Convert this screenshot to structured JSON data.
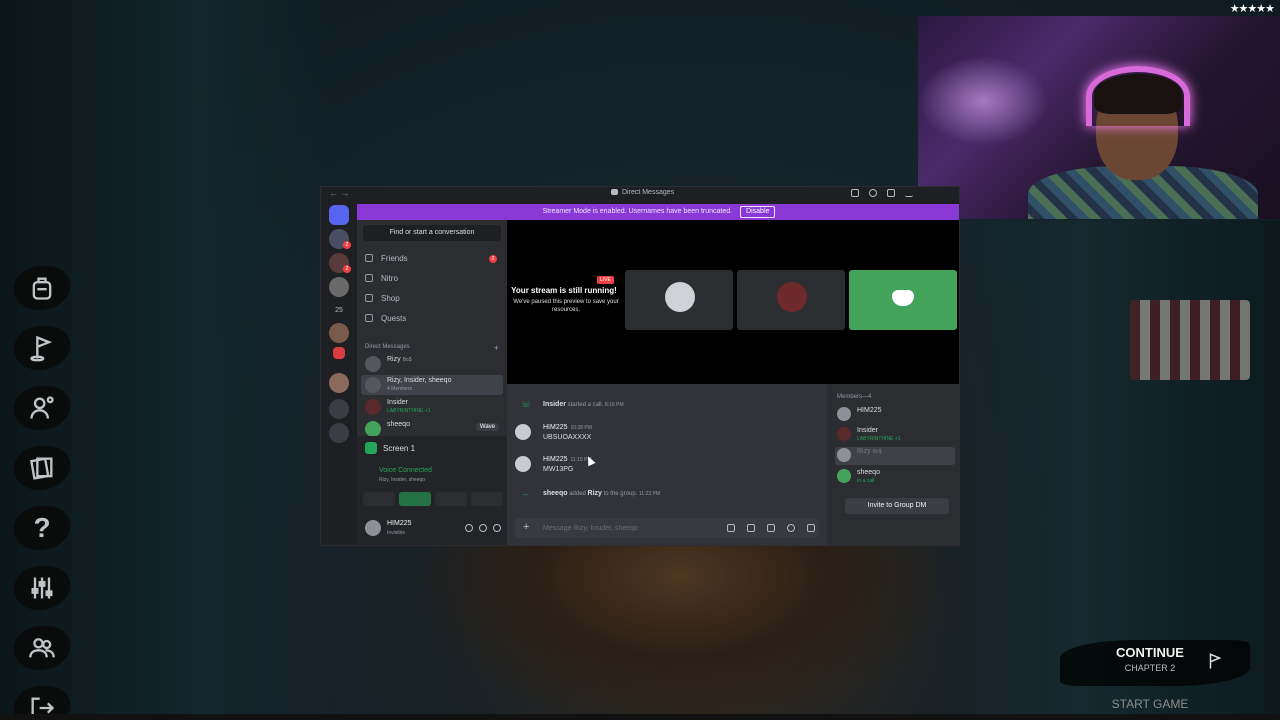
{
  "game": {
    "rating": "★★★★★",
    "continue_label": "CONTINUE",
    "chapter_label": "CHAPTER 2",
    "start_game_label": "START GAME",
    "menu_icons": [
      "backpack-icon",
      "flag-icon",
      "character-icon",
      "cards-icon",
      "help-icon",
      "settings-sliders-icon",
      "friends-icon",
      "exit-icon"
    ]
  },
  "discord": {
    "window_title": "Direct Messages",
    "streamer_banner": "Streamer Mode is enabled. Usernames have been truncated.",
    "streamer_disable_label": "Disable",
    "guild_badges": [
      "2",
      "2"
    ],
    "guild_count_label": "25",
    "find_label": "Find or start a conversation",
    "nav": [
      {
        "label": "Friends",
        "icon": "friends-icon",
        "badge": "2"
      },
      {
        "label": "Nitro",
        "icon": "nitro-icon"
      },
      {
        "label": "Shop",
        "icon": "shop-icon"
      },
      {
        "label": "Quests",
        "icon": "quests-icon"
      }
    ],
    "dm_header": "Direct Messages",
    "dms": [
      {
        "name": "Rizy",
        "tag": "Bo$"
      },
      {
        "name": "Rizy, Insider, sheeqo",
        "sub": "4 Members"
      },
      {
        "name": "Insider",
        "sub": "LABYRINTHINE +1"
      },
      {
        "name": "sheeqo",
        "action": "Wave"
      }
    ],
    "voice": {
      "screen_label": "Screen 1",
      "status": "Voice Connected",
      "members": "Rizy, Insider, sheeqo"
    },
    "user": {
      "name": "HIM225",
      "status": "Invisible"
    },
    "stream": {
      "live_label": "LIVE",
      "title": "Your stream is still running!",
      "subtitle": "We've paused this preview to save your resources."
    },
    "messages": {
      "call": {
        "author": "Insider",
        "text": "started a call.",
        "time": "8:16 PM"
      },
      "msg1": {
        "author": "HIM225",
        "time": "10:28 PM",
        "text": "UBSUOAXXXX"
      },
      "msg2": {
        "author": "HIM225",
        "time": "11:15 PM",
        "text": "MW13PG"
      },
      "added": {
        "author": "sheeqo",
        "verb": "added",
        "target": "Rizy",
        "tail": "to the group.",
        "time": "11:23 PM"
      }
    },
    "composer_placeholder": "Message Rizy, Insider, sheeqo",
    "members_header": "Members—4",
    "members": [
      {
        "name": "HIM225"
      },
      {
        "name": "Insider",
        "sub": "LABYRINTHINE +1"
      },
      {
        "name": "Rizy",
        "tag": "Bo$"
      },
      {
        "name": "sheeqo",
        "sub": "In a call"
      }
    ],
    "invite_label": "Invite to Group DM",
    "accent": "#8a38d6",
    "online_color": "#23a559"
  }
}
